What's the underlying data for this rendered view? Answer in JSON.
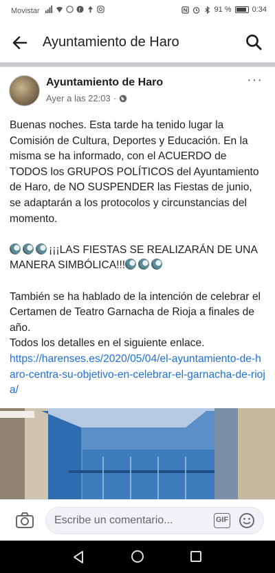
{
  "status_bar": {
    "carrier": "Movistar",
    "battery_percent": "91 %",
    "battery_level": 0.91,
    "time": "0:34"
  },
  "header": {
    "title": "Ayuntamiento de Haro"
  },
  "post": {
    "author": "Ayuntamiento de Haro",
    "timestamp": "Ayer a las 22:03",
    "separator": "·",
    "more": "···",
    "paragraph_1": "Buenas noches. Esta tarde ha tenido lugar la Comisión de Cultura, Deportes y Educación. En la misma se ha informado, con el ACUERDO de TODOS los GRUPOS POLÍTICOS del Ayuntamiento de Haro, de NO SUSPENDER las Fiestas de junio, se adaptarán a los protocolos y circunstancias del momento.",
    "announcement": "¡¡¡LAS FIESTAS SE REALIZARÁN DE UNA MANERA SIMBÓLICA!!!",
    "paragraph_2": "También se ha hablado de la intención de celebrar el Certamen de Teatro Garnacha de Rioja a finales de año.",
    "paragraph_3": "Todos los detalles en el siguiente enlace.",
    "link": "https://harenses.es/2020/05/04/el-ayuntamiento-de-haro-centra-su-objetivo-en-celebrar-el-garnacha-de-rioja/"
  },
  "comment_bar": {
    "placeholder": "Escribe un comentario...",
    "gif_label": "GIF"
  },
  "colors": {
    "link": "#216fdb",
    "text": "#1c1e21",
    "secondary": "#65676b"
  }
}
